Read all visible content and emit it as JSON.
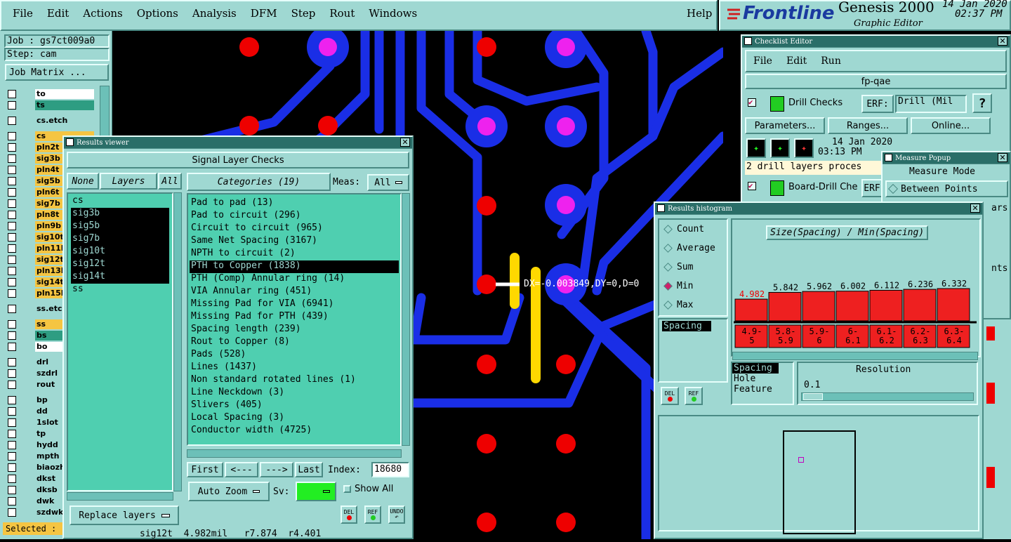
{
  "menubar": [
    "File",
    "Edit",
    "Actions",
    "Options",
    "Analysis",
    "DFM",
    "Step",
    "Rout",
    "Windows"
  ],
  "help": "Help",
  "brand": {
    "logo": "Frontline",
    "product": "Genesis 2000",
    "sub": "Graphic Editor",
    "date": "14 Jan 2020",
    "time": "02:37 PM"
  },
  "job": {
    "job_label": "Job : gs7ct009a0",
    "step_label": "Step: cam",
    "matrix_btn": "Job Matrix ...",
    "selected": "Selected :"
  },
  "layers": [
    {
      "name": "to",
      "color": "#ffffff"
    },
    {
      "name": "ts",
      "color": "#2e9d82"
    },
    {
      "name": "cs.etch",
      "color": "#9fd8d2"
    },
    {
      "name": "cs",
      "color": "#f5c542"
    },
    {
      "name": "pln2t",
      "color": "#f5c542"
    },
    {
      "name": "sig3b",
      "color": "#f5c542"
    },
    {
      "name": "pln4t",
      "color": "#f5c542"
    },
    {
      "name": "sig5b",
      "color": "#f5c542"
    },
    {
      "name": "pln6t",
      "color": "#f5c542"
    },
    {
      "name": "sig7b",
      "color": "#f5c542"
    },
    {
      "name": "pln8t",
      "color": "#f5c542"
    },
    {
      "name": "pln9b",
      "color": "#f5c542"
    },
    {
      "name": "sig10t",
      "color": "#f5c542"
    },
    {
      "name": "pln11b",
      "color": "#f5c542"
    },
    {
      "name": "sig12t",
      "color": "#f5c542"
    },
    {
      "name": "pln13b",
      "color": "#f5c542"
    },
    {
      "name": "sig14t",
      "color": "#f5c542"
    },
    {
      "name": "pln15b",
      "color": "#f5c542"
    },
    {
      "name": "ss.etch",
      "color": "#9fd8d2"
    },
    {
      "name": "ss",
      "color": "#f5c542"
    },
    {
      "name": "bs",
      "color": "#2e9d82"
    },
    {
      "name": "bo",
      "color": "#ffffff"
    },
    {
      "name": "drl",
      "color": "#9fd8d2"
    },
    {
      "name": "szdrl",
      "color": "#9fd8d2"
    },
    {
      "name": "rout",
      "color": "#9fd8d2"
    },
    {
      "name": "bp",
      "color": "#9fd8d2"
    },
    {
      "name": "dd",
      "color": "#9fd8d2"
    },
    {
      "name": "1slot",
      "color": "#9fd8d2"
    },
    {
      "name": "tp",
      "color": "#9fd8d2"
    },
    {
      "name": "hydd",
      "color": "#9fd8d2"
    },
    {
      "name": "mpth",
      "color": "#9fd8d2"
    },
    {
      "name": "biaozh",
      "color": "#9fd8d2"
    },
    {
      "name": "dkst",
      "color": "#9fd8d2"
    },
    {
      "name": "dksb",
      "color": "#9fd8d2"
    },
    {
      "name": "dwk",
      "color": "#9fd8d2"
    },
    {
      "name": "szdwk",
      "color": "#9fd8d2"
    }
  ],
  "results_viewer": {
    "title": "Results viewer",
    "header": "Signal Layer Checks",
    "none_btn": "None",
    "layers_btn": "Layers",
    "all_btn": "All",
    "categories_btn": "Categories (19)",
    "meas_label": "Meas:",
    "meas_value": "All",
    "layer_list": [
      "cs",
      "sig3b",
      "sig5b",
      "sig7b",
      "sig10t",
      "sig12t",
      "sig14t",
      "ss"
    ],
    "categories": [
      "Pad to pad (13)",
      "Pad to circuit (296)",
      "Circuit to circuit (965)",
      "Same Net Spacing (3167)",
      "NPTH to circuit (2)",
      "PTH to Copper (1838)",
      "PTH (Comp) Annular ring (14)",
      "VIA Annular ring (451)",
      "Missing Pad for VIA (6941)",
      "Missing Pad for PTH (439)",
      "Spacing length (239)",
      "Rout to Copper (8)",
      "Pads (528)",
      "Lines (1437)",
      "Non standard rotated lines (1)",
      "Line Neckdown (3)",
      "Slivers (405)",
      "Local Spacing (3)",
      "Conductor width (4725)"
    ],
    "nav": {
      "first": "First",
      "prev": "<---",
      "next": "--->",
      "last": "Last",
      "index_label": "Index:",
      "index_value": "18680"
    },
    "auto_zoom": "Auto Zoom",
    "sv_label": "Sv:",
    "show_all": "Show All",
    "replace_layers": "Replace layers",
    "del": "DEL",
    "ref": "REF",
    "undo": "UNDO",
    "status": "sig12t  4.982mil   r7.874  r4.401"
  },
  "canvas": {
    "measure": "DX=-0.003849,DY=0,D=0"
  },
  "checklist": {
    "title": "Checklist Editor",
    "menu": [
      "File",
      "Edit",
      "Run"
    ],
    "name": "fp-qae",
    "check1": "Drill Checks",
    "erf": "ERF:",
    "erf_value": "Drill (Mil",
    "buttons": [
      "Parameters...",
      "Ranges...",
      "Online..."
    ],
    "date": "14 Jan 2020",
    "time": "03:13 PM",
    "status": "2 drill layers proces",
    "check2": "Board-Drill Che",
    "erf2": "ERF"
  },
  "measure_popup": {
    "title": "Measure Popup",
    "mode": "Measure Mode",
    "between": "Between Points",
    "side1": "ars",
    "side2": "nts"
  },
  "histogram": {
    "title": "Results histogram",
    "options": [
      "Count",
      "Average",
      "Sum",
      "Min",
      "Max"
    ],
    "selected_option": "Min",
    "chart_title": "Size(Spacing) / Min(Spacing)",
    "values": [
      "4.982",
      "5.842",
      "5.962",
      "6.002",
      "6.112",
      "6.236",
      "6.332"
    ],
    "ranges": [
      "4.9-5",
      "5.8-5.9",
      "5.9-6",
      "6-6.1",
      "6.1-6.2",
      "6.2-6.3",
      "6.3-6.4"
    ],
    "list_left": [
      "Spacing"
    ],
    "list_right": [
      "Spacing",
      "Hole",
      "Feature"
    ],
    "resolution_label": "Resolution",
    "resolution_value": "0.1",
    "del": "DEL",
    "ref": "REF"
  },
  "chart_data": {
    "type": "bar",
    "title": "Size(Spacing) / Min(Spacing)",
    "categories": [
      "4.9-5",
      "5.8-5.9",
      "5.9-6",
      "6-6.1",
      "6.1-6.2",
      "6.2-6.3",
      "6.3-6.4"
    ],
    "values": [
      4.982,
      5.842,
      5.962,
      6.002,
      6.112,
      6.236,
      6.332
    ]
  }
}
